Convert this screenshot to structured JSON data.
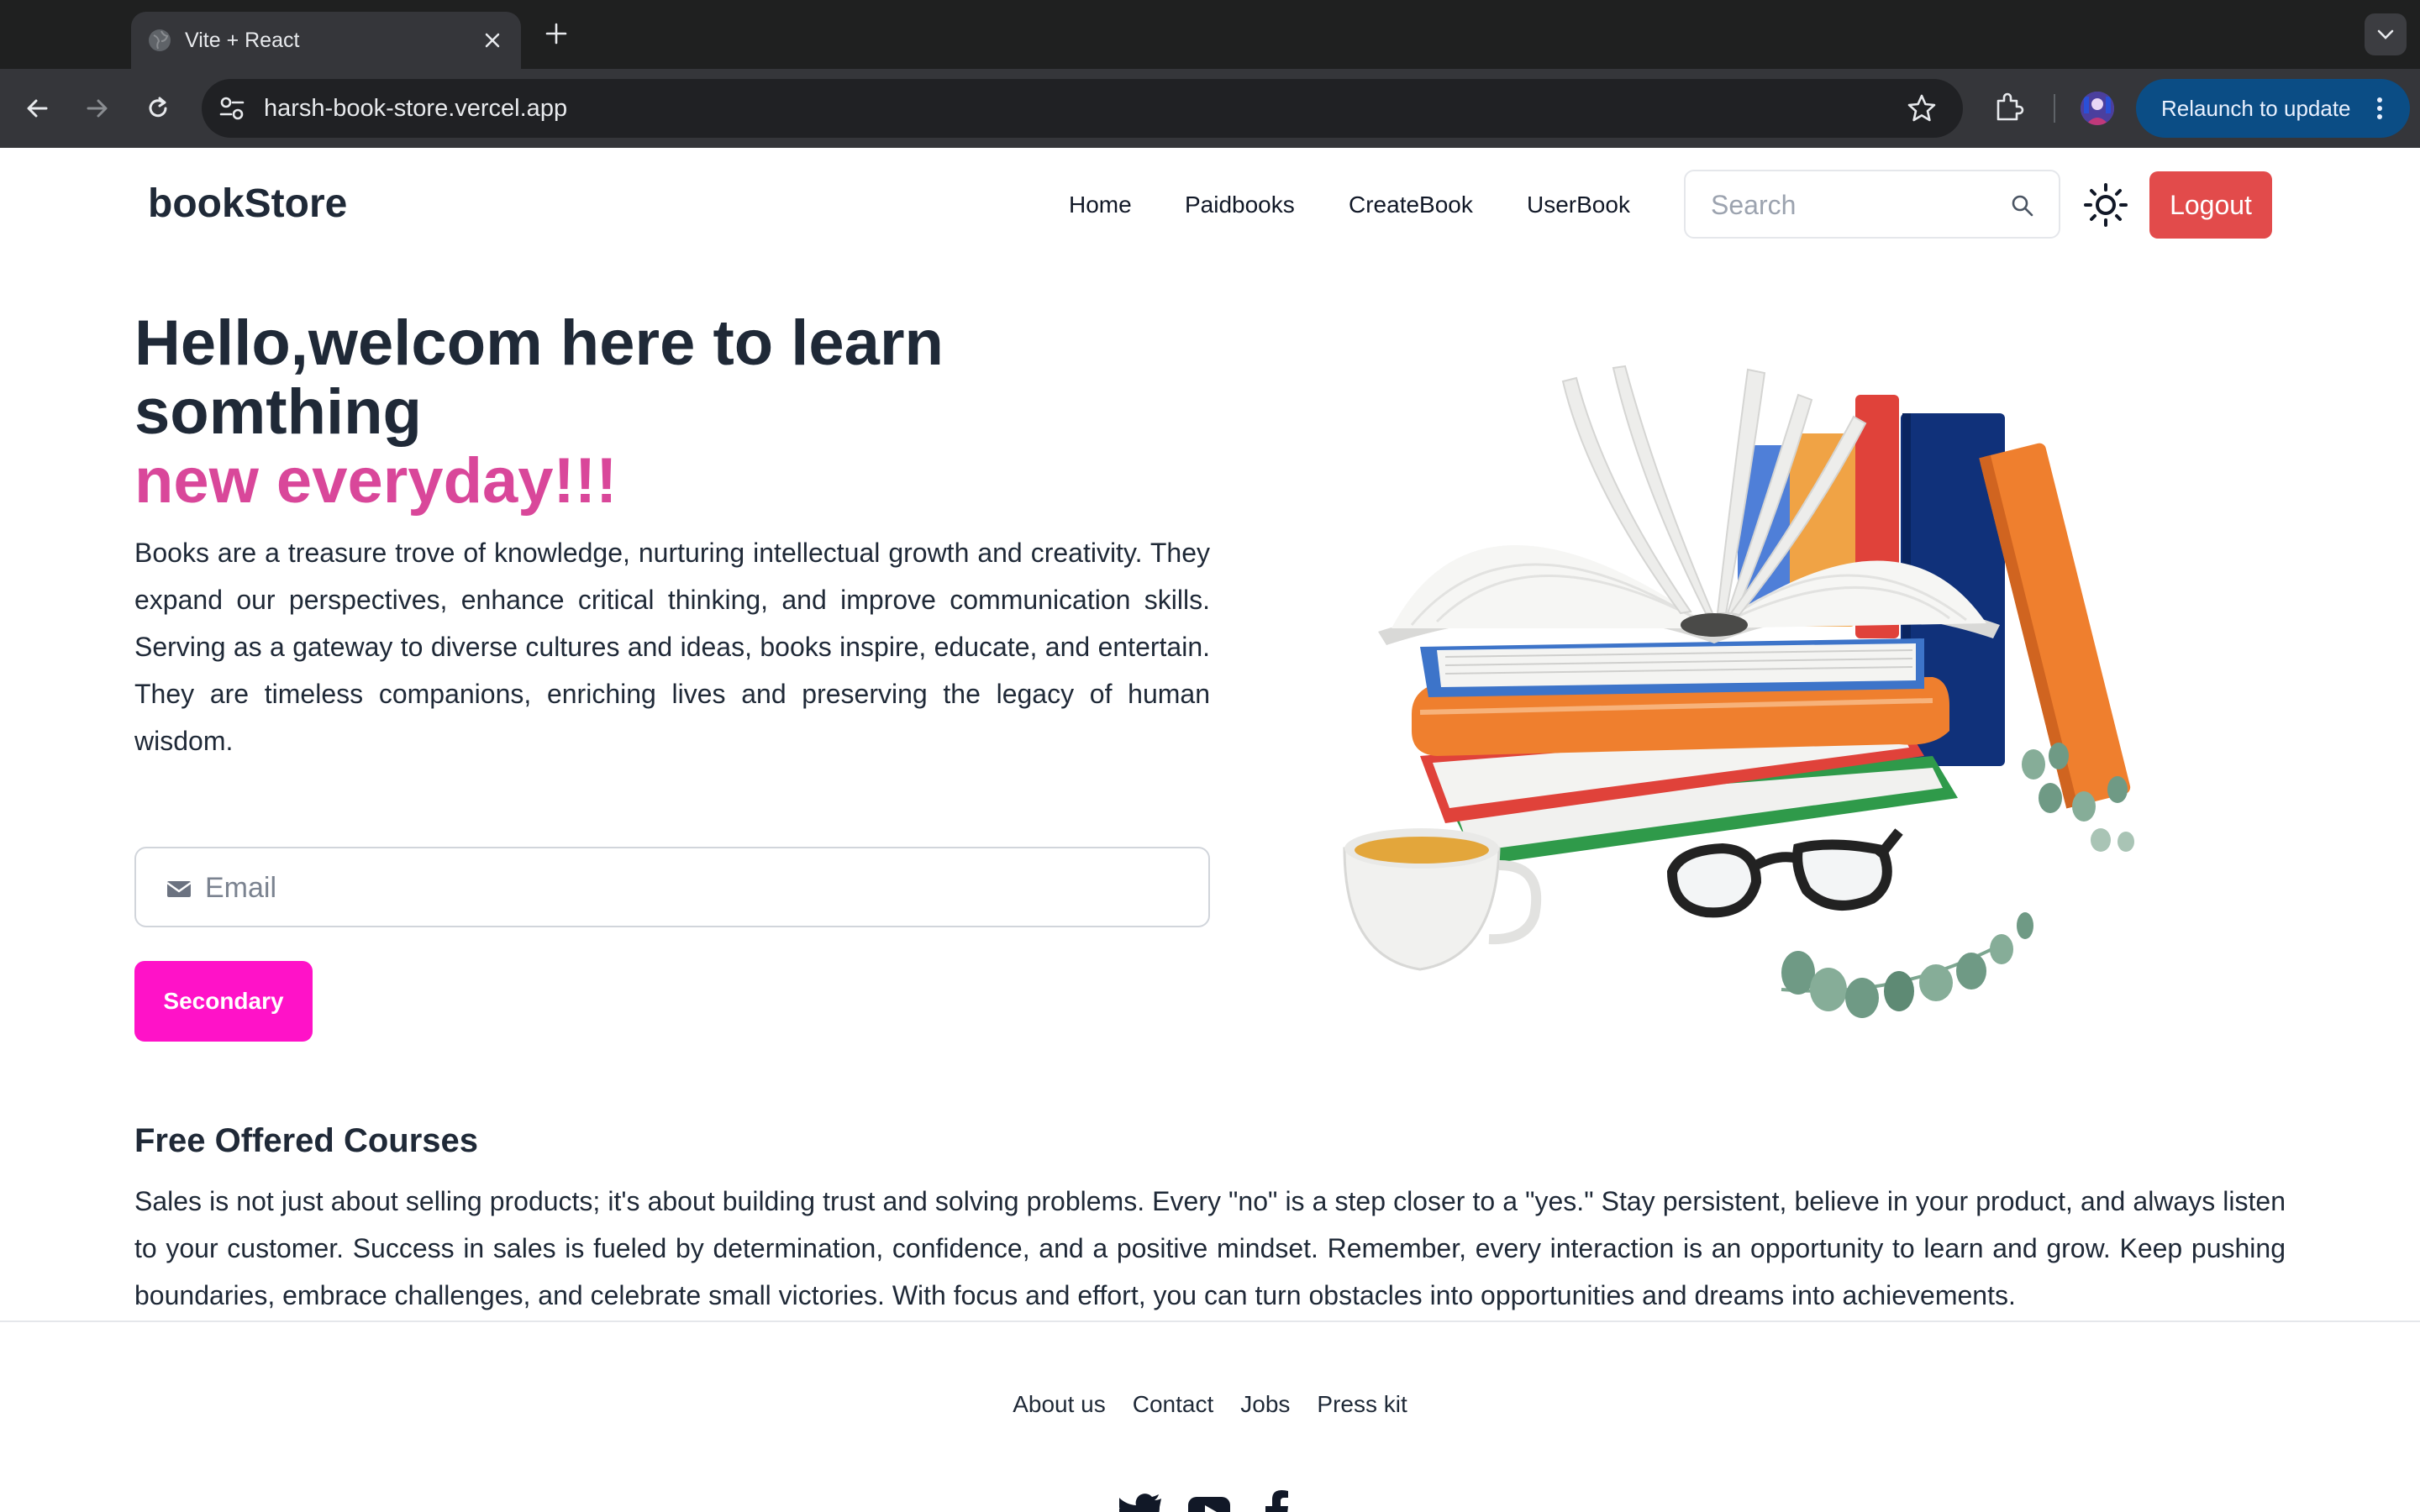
{
  "browser": {
    "tab_title": "Vite + React",
    "url": "harsh-book-store.vercel.app",
    "relaunch_label": "Relaunch to update",
    "colors": {
      "tabbar": "#1f2020",
      "toolbar": "#35363a",
      "omnibox": "#202124",
      "relaunch": "#0b4d85"
    },
    "icons": [
      "globe-icon",
      "close-icon",
      "plus-icon",
      "chevron-down-icon",
      "back-arrow-icon",
      "forward-arrow-icon",
      "reload-icon",
      "site-settings-icon",
      "star-icon",
      "extensions-icon",
      "profile-avatar",
      "more-vert-icon"
    ]
  },
  "navbar": {
    "brand": "bookStore",
    "links": [
      "Home",
      "Paidbooks",
      "CreateBook",
      "UserBook"
    ],
    "search_placeholder": "Search",
    "logout_label": "Logout",
    "theme_icon": "sun-icon",
    "colors": {
      "logout": "#e24b4b"
    }
  },
  "hero": {
    "title": "Hello,welcom here to learn somthing",
    "title_accent": "new everyday!!!",
    "description": "Books are a treasure trove of knowledge, nurturing intellectual growth and creativity. They expand our perspectives, enhance critical thinking, and improve communication skills. Serving as a gateway to diverse cultures and ideas, books inspire, educate, and entertain. They are timeless companions, enriching lives and preserving the legacy of human wisdom.",
    "email_placeholder": "Email",
    "button_label": "Secondary",
    "illustration": "stack-of-books-illustration",
    "colors": {
      "accent": "#d9479a",
      "button": "#ff12c8"
    }
  },
  "courses": {
    "title": "Free Offered Courses",
    "text": "Sales is not just about selling products; it's about building trust and solving problems. Every \"no\" is a step closer to a \"yes.\" Stay persistent, believe in your product, and always listen to your customer. Success in sales is fueled by determination, confidence, and a positive mindset. Remember, every interaction is an opportunity to learn and grow. Keep pushing boundaries, embrace challenges, and celebrate small victories. With focus and effort, you can turn obstacles into opportunities and dreams into achievements."
  },
  "footer": {
    "links": [
      "About us",
      "Contact",
      "Jobs",
      "Press kit"
    ],
    "social_icons": [
      "twitter-icon",
      "youtube-icon",
      "facebook-icon"
    ]
  }
}
